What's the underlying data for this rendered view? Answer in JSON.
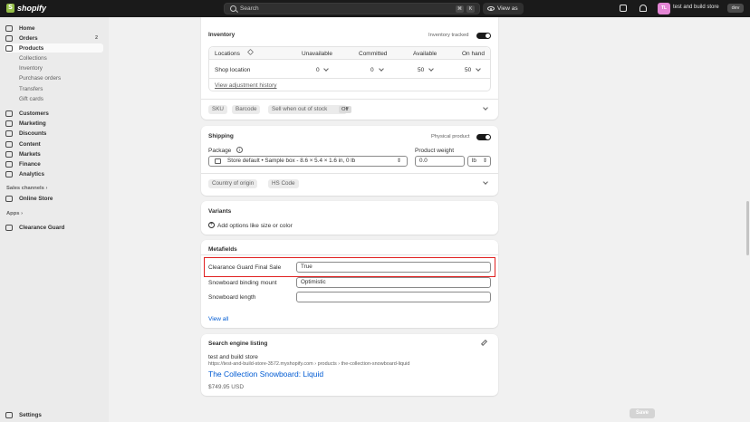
{
  "topbar": {
    "logo_text": "shopify",
    "search_placeholder": "Search",
    "kbd1": "⌘",
    "kbd2": "K",
    "view_as": "View as",
    "avatar_initials": "TL",
    "store_name": "test and build store",
    "dev_badge": "dev"
  },
  "sidebar": {
    "home": "Home",
    "orders": "Orders",
    "orders_count": "2",
    "products": "Products",
    "sub": [
      "Collections",
      "Inventory",
      "Purchase orders",
      "Transfers",
      "Gift cards"
    ],
    "customers": "Customers",
    "marketing": "Marketing",
    "discounts": "Discounts",
    "content": "Content",
    "markets": "Markets",
    "finance": "Finance",
    "analytics": "Analytics",
    "sales_channels": "Sales channels",
    "online_store": "Online Store",
    "apps": "Apps",
    "clearance_guard": "Clearance Guard",
    "settings": "Settings"
  },
  "inventory": {
    "title": "Inventory",
    "tracked_label": "Inventory tracked",
    "tracked": true,
    "col_locations": "Locations",
    "col_unavailable": "Unavailable",
    "col_committed": "Committed",
    "col_available": "Available",
    "col_onhand": "On hand",
    "row_location": "Shop location",
    "row_unavailable": "0",
    "row_committed": "0",
    "row_available": "50",
    "row_onhand": "50",
    "history_link": "View adjustment history",
    "sku": "SKU",
    "barcode": "Barcode",
    "sell_oos": "Sell when out of stock",
    "sell_oos_value": "Off"
  },
  "shipping": {
    "title": "Shipping",
    "physical_label": "Physical product",
    "physical": true,
    "package_label": "Package",
    "package_value": "Store default • Sample box - 8.6 × 5.4 × 1.6 in, 0 lb",
    "weight_label": "Product weight",
    "weight_value": "0.0",
    "weight_unit": "lb",
    "country": "Country of origin",
    "hs_code": "HS Code"
  },
  "variants": {
    "title": "Variants",
    "add_options": "Add options like size or color"
  },
  "metafields": {
    "title": "Metafields",
    "rows": [
      {
        "label": "Clearance Guard Final Sale",
        "value": "True"
      },
      {
        "label": "Snowboard binding mount",
        "value": "Optimistic"
      },
      {
        "label": "Snowboard length",
        "value": ""
      }
    ],
    "view_all": "View all",
    "highlight_color": "#e02020"
  },
  "seo": {
    "title": "Search engine listing",
    "store": "test and build store",
    "url": "https://test-and-build-store-3572.myshopify.com › products › the-collection-snowboard-liquid",
    "page_title": "The Collection Snowboard: Liquid",
    "price": "$749.95 USD"
  },
  "footer": {
    "save": "Save"
  },
  "colors": {
    "topbar": "#1a1a1a",
    "link": "#005bd3",
    "avatar": "#e385d4"
  }
}
